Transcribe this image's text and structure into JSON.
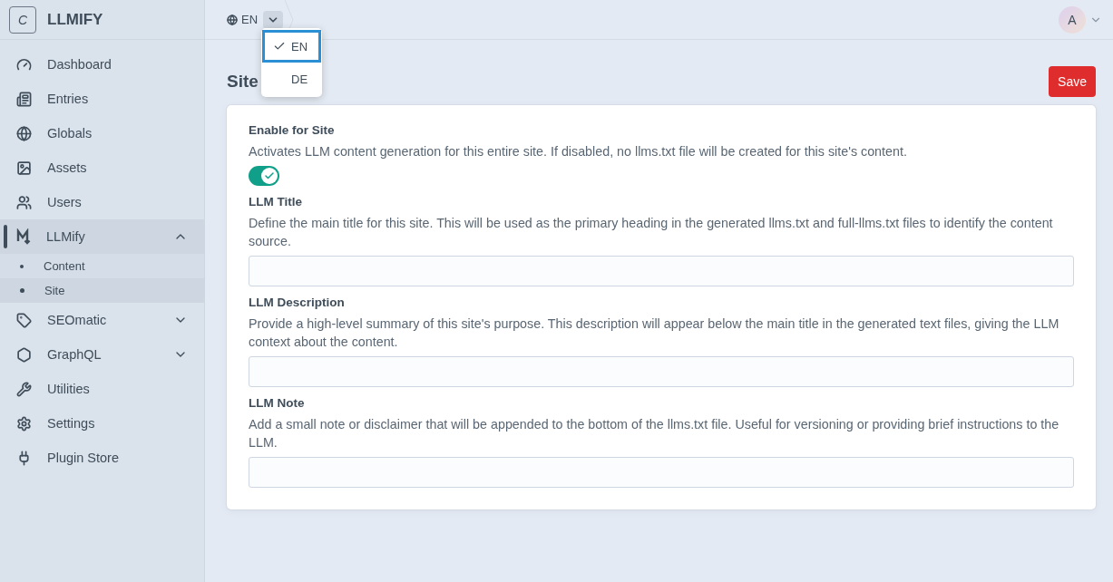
{
  "brand": {
    "logo_letter": "C",
    "name": "LLMIFY"
  },
  "sidebar": {
    "items": [
      {
        "label": "Dashboard",
        "selected": false
      },
      {
        "label": "Entries",
        "selected": false
      },
      {
        "label": "Globals",
        "selected": false
      },
      {
        "label": "Assets",
        "selected": false
      },
      {
        "label": "Users",
        "selected": false
      },
      {
        "label": "LLMify",
        "selected": true,
        "expanded": true,
        "children": [
          {
            "label": "Content",
            "selected": false
          },
          {
            "label": "Site",
            "selected": true
          }
        ]
      },
      {
        "label": "SEOmatic",
        "selected": false,
        "expanded": false
      },
      {
        "label": "GraphQL",
        "selected": false,
        "expanded": false
      },
      {
        "label": "Utilities",
        "selected": false
      },
      {
        "label": "Settings",
        "selected": false
      },
      {
        "label": "Plugin Store",
        "selected": false
      }
    ]
  },
  "header": {
    "site_label": "EN",
    "avatar": "A"
  },
  "site_menu": {
    "options": [
      {
        "label": "EN",
        "selected": true
      },
      {
        "label": "DE",
        "selected": false
      }
    ]
  },
  "page": {
    "title": "Site",
    "save_button": "Save"
  },
  "fields": [
    {
      "kind": "toggle",
      "label": "Enable for Site",
      "instructions": "Activates LLM content generation for this entire site. If disabled, no llms.txt file will be created for this site's content.",
      "on": true
    },
    {
      "kind": "text",
      "label": "LLM Title",
      "instructions": "Define the main title for this site. This will be used as the primary heading in the generated llms.txt and full-llms.txt files to identify the content source."
    },
    {
      "kind": "text",
      "label": "LLM Description",
      "instructions": "Provide a high-level summary of this site's purpose. This description will appear below the main title in the generated text files, giving the LLM context about the content."
    },
    {
      "kind": "text",
      "label": "LLM Note",
      "instructions": "Add a small note or disclaimer that will be appended to the bottom of the llms.txt file. Useful for versioning or providing brief instructions to the LLM."
    }
  ]
}
